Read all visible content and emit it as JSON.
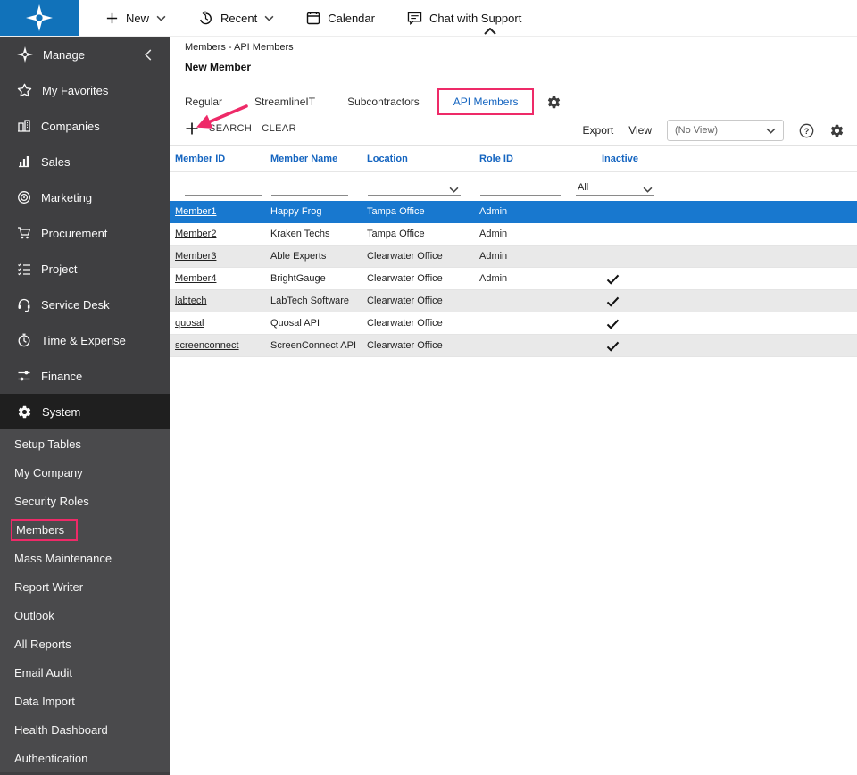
{
  "topbar": {
    "items": [
      {
        "label": "New",
        "icon": "plus-icon",
        "chevron": true
      },
      {
        "label": "Recent",
        "icon": "history-icon",
        "chevron": true
      },
      {
        "label": "Calendar",
        "icon": "calendar-icon",
        "chevron": false
      },
      {
        "label": "Chat with Support",
        "icon": "chat-icon",
        "chevron": false
      }
    ]
  },
  "sidebar": {
    "items": [
      {
        "label": "Manage",
        "icon": "compass-icon",
        "collapse": true
      },
      {
        "label": "My Favorites",
        "icon": "star-icon"
      },
      {
        "label": "Companies",
        "icon": "buildings-icon"
      },
      {
        "label": "Sales",
        "icon": "chart-icon"
      },
      {
        "label": "Marketing",
        "icon": "target-icon"
      },
      {
        "label": "Procurement",
        "icon": "cart-icon"
      },
      {
        "label": "Project",
        "icon": "tasks-icon"
      },
      {
        "label": "Service Desk",
        "icon": "headset-icon"
      },
      {
        "label": "Time & Expense",
        "icon": "clock-icon"
      },
      {
        "label": "Finance",
        "icon": "sliders-icon"
      },
      {
        "label": "System",
        "icon": "gear-icon",
        "active": true
      }
    ],
    "subitems": [
      {
        "label": "Setup Tables"
      },
      {
        "label": "My Company"
      },
      {
        "label": "Security Roles"
      },
      {
        "label": "Members",
        "annotated": true
      },
      {
        "label": "Mass Maintenance"
      },
      {
        "label": "Report Writer"
      },
      {
        "label": "Outlook"
      },
      {
        "label": "All Reports"
      },
      {
        "label": "Email Audit"
      },
      {
        "label": "Data Import"
      },
      {
        "label": "Health Dashboard"
      },
      {
        "label": "Authentication"
      }
    ]
  },
  "main": {
    "breadcrumb": "Members - API Members",
    "title": "New Member",
    "tabs": [
      {
        "label": "Regular"
      },
      {
        "label": "StreamlineIT"
      },
      {
        "label": "Subcontractors"
      },
      {
        "label": "API Members",
        "active": true,
        "annotated": true
      }
    ],
    "toolbar": {
      "search": "SEARCH",
      "clear": "CLEAR",
      "export": "Export",
      "view": "View",
      "view_value": "(No View)"
    },
    "grid": {
      "columns": [
        "Member ID",
        "Member Name",
        "Location",
        "Role ID",
        "Inactive"
      ],
      "filters": {
        "inactive": "All"
      },
      "rows": [
        {
          "member_id": "Member1",
          "member_name": "Happy Frog",
          "location": "Tampa Office",
          "role_id": "Admin",
          "inactive": false,
          "selected": true
        },
        {
          "member_id": "Member2",
          "member_name": "Kraken Techs",
          "location": "Tampa Office",
          "role_id": "Admin",
          "inactive": false
        },
        {
          "member_id": "Member3",
          "member_name": "Able Experts",
          "location": "Clearwater Office",
          "role_id": "Admin",
          "inactive": false
        },
        {
          "member_id": "Member4",
          "member_name": "BrightGauge",
          "location": "Clearwater Office",
          "role_id": "Admin",
          "inactive": true
        },
        {
          "member_id": "labtech",
          "member_name": "LabTech Software",
          "location": "Clearwater Office",
          "role_id": "",
          "inactive": true
        },
        {
          "member_id": "quosal",
          "member_name": "Quosal API",
          "location": "Clearwater Office",
          "role_id": "",
          "inactive": true
        },
        {
          "member_id": "screenconnect",
          "member_name": "ScreenConnect API",
          "location": "Clearwater Office",
          "role_id": "",
          "inactive": true
        }
      ]
    }
  },
  "colors": {
    "brand_blue": "#1172ba",
    "selected_row_blue": "#1878cf",
    "header_text_blue": "#1565c0",
    "annotation_pink": "#ee2a68",
    "sidebar_gray": "#3f3f41"
  }
}
